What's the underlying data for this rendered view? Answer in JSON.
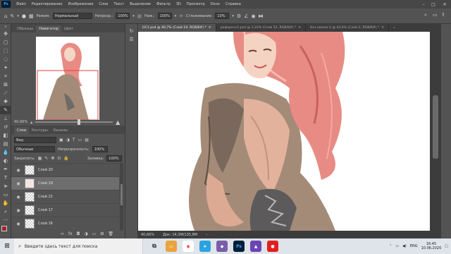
{
  "menubar": {
    "logo": "Ps",
    "items": [
      "Файл",
      "Редактирование",
      "Изображение",
      "Слои",
      "Текст",
      "Выделение",
      "Фильтр",
      "3D",
      "Просмотр",
      "Окно",
      "Справка"
    ]
  },
  "options": {
    "mode_label": "Режим:",
    "mode_value": "Нормальный",
    "opacity_label": "Непрозр.:",
    "opacity_value": "100%",
    "pressure_label": "Наж.:",
    "pressure_value": "100%",
    "smoothing_label": "Сглаживание:",
    "smoothing_value": "10%"
  },
  "left_panel": {
    "tabs": [
      "Образцы",
      "Навигатор",
      "Цвет"
    ],
    "active_tab": "Навигатор",
    "zoom_value": "40,66%"
  },
  "layers_panel": {
    "tabs": [
      "Слои",
      "Контуры",
      "Каналы"
    ],
    "search_kind": "Вид",
    "blend_mode": "Обычные",
    "opacity_label": "Непрозрачность:",
    "opacity_value": "100%",
    "lock_label": "Закрепить:",
    "fill_label": "Заливка:",
    "fill_value": "100%",
    "layers": [
      {
        "name": "Слой 20"
      },
      {
        "name": "Слой 19"
      },
      {
        "name": "Слой 21"
      },
      {
        "name": "Слой 17"
      },
      {
        "name": "Слой 16"
      }
    ]
  },
  "document_tabs": [
    {
      "label": "ОС1.psd @ 40,7% (Слой 19, RGB/8#) *"
    },
    {
      "label": "референс1.psd @ 3,33% (Слой 52, RGB/8#) *"
    },
    {
      "label": "Без имени-2 @ 44,9% (Слой 2, RGB/8#) *"
    }
  ],
  "status": {
    "zoom": "40,66%",
    "doc_size": "Док: 14,3M/135,8M"
  },
  "taskbar": {
    "search_placeholder": "Введите здесь текст для поиска",
    "language": "ENG",
    "time": "16:45",
    "date": "10.06.2020"
  },
  "colors": {
    "accent": "#31a8ff",
    "hair": "#e88b84",
    "dress": "#9f8878",
    "foreground_swatch": "#9b2a24",
    "background_swatch": "#ffffff"
  }
}
